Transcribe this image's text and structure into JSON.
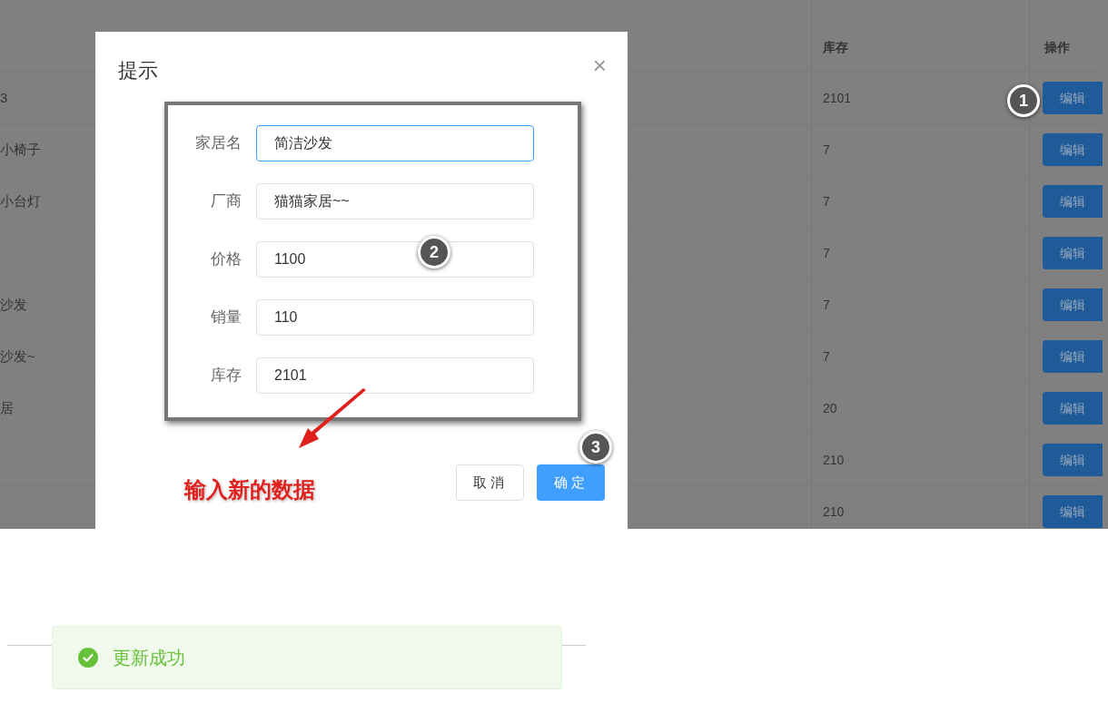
{
  "table": {
    "columns": [
      {
        "label": "库存"
      },
      {
        "label": "操作"
      }
    ],
    "rows": [
      {
        "name": "3",
        "stock": "2101",
        "action": "编辑"
      },
      {
        "name": "小椅子",
        "stock": "7",
        "action": "编辑"
      },
      {
        "name": "小台灯",
        "stock": "7",
        "action": "编辑"
      },
      {
        "stock": "7",
        "action": "编辑"
      },
      {
        "name": "沙发",
        "stock": "7",
        "action": "编辑"
      },
      {
        "name": "沙发~",
        "stock": "7",
        "action": "编辑"
      },
      {
        "name": "居",
        "stock": "20",
        "action": "编辑"
      },
      {
        "stock": "210",
        "action": "编辑"
      },
      {
        "stock": "210",
        "action": "编辑"
      }
    ]
  },
  "dialog": {
    "title": "提示",
    "close": "×",
    "fields": [
      {
        "label": "家居名",
        "value": "简洁沙发",
        "focused": true
      },
      {
        "label": "厂商",
        "value": "猫猫家居~~",
        "focused": false
      },
      {
        "label": "价格",
        "value": "1100",
        "focused": false
      },
      {
        "label": "销量",
        "value": "110",
        "focused": false
      },
      {
        "label": "库存",
        "value": "2101",
        "focused": false
      }
    ],
    "buttons": [
      {
        "label": "取消",
        "kind": "default"
      },
      {
        "label": "确定",
        "kind": "primary"
      }
    ]
  },
  "annotations": {
    "markers": [
      "1",
      "2",
      "3"
    ],
    "note": "输入新的数据"
  },
  "toast": {
    "message": "更新成功",
    "kind": "success"
  }
}
